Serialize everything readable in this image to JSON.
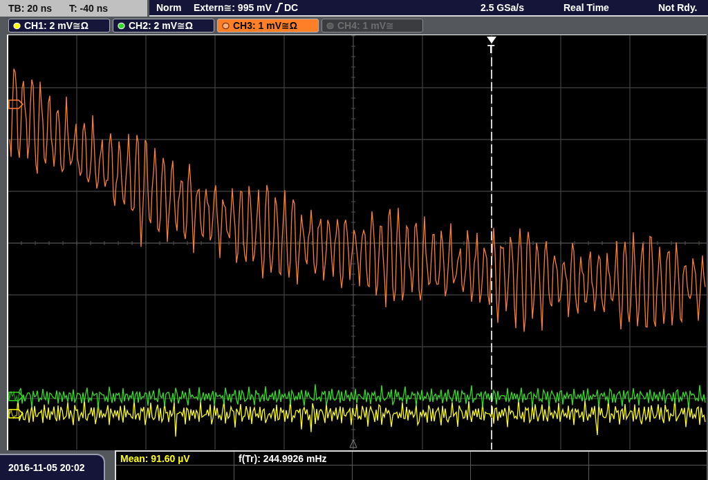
{
  "status_bar": {
    "timebase": "TB: 20 ns",
    "trigger_offset": "T: -40 ns",
    "trigger_mode": "Norm",
    "trigger_source": "Extern≅: 995 mV",
    "trigger_slope_rising": true,
    "trigger_coupling": "DC",
    "sample_rate": "2.5 GSa/s",
    "acquisition_mode": "Real Time",
    "status": "Not Rdy."
  },
  "channels": [
    {
      "label": "CH1: 2 mV≅Ω",
      "color": "#ffff00",
      "selected": false,
      "on": true
    },
    {
      "label": "CH2: 2 mV≅Ω",
      "color": "#33dd22",
      "selected": false,
      "on": true
    },
    {
      "label": "CH3: 1 mV≅Ω",
      "color": "#ff7f27",
      "selected": true,
      "on": true
    },
    {
      "label": "CH4: 1 mV≅",
      "selected": false,
      "on": false
    }
  ],
  "display": {
    "trigger_marker": "T"
  },
  "measurements": [
    {
      "text": "Mean: 91.60 µV",
      "kind": "mean"
    },
    {
      "text": "f(Tr): 244.9926 mHz",
      "kind": "frequency"
    }
  ],
  "datetime": "2016-11-05 20:02"
}
